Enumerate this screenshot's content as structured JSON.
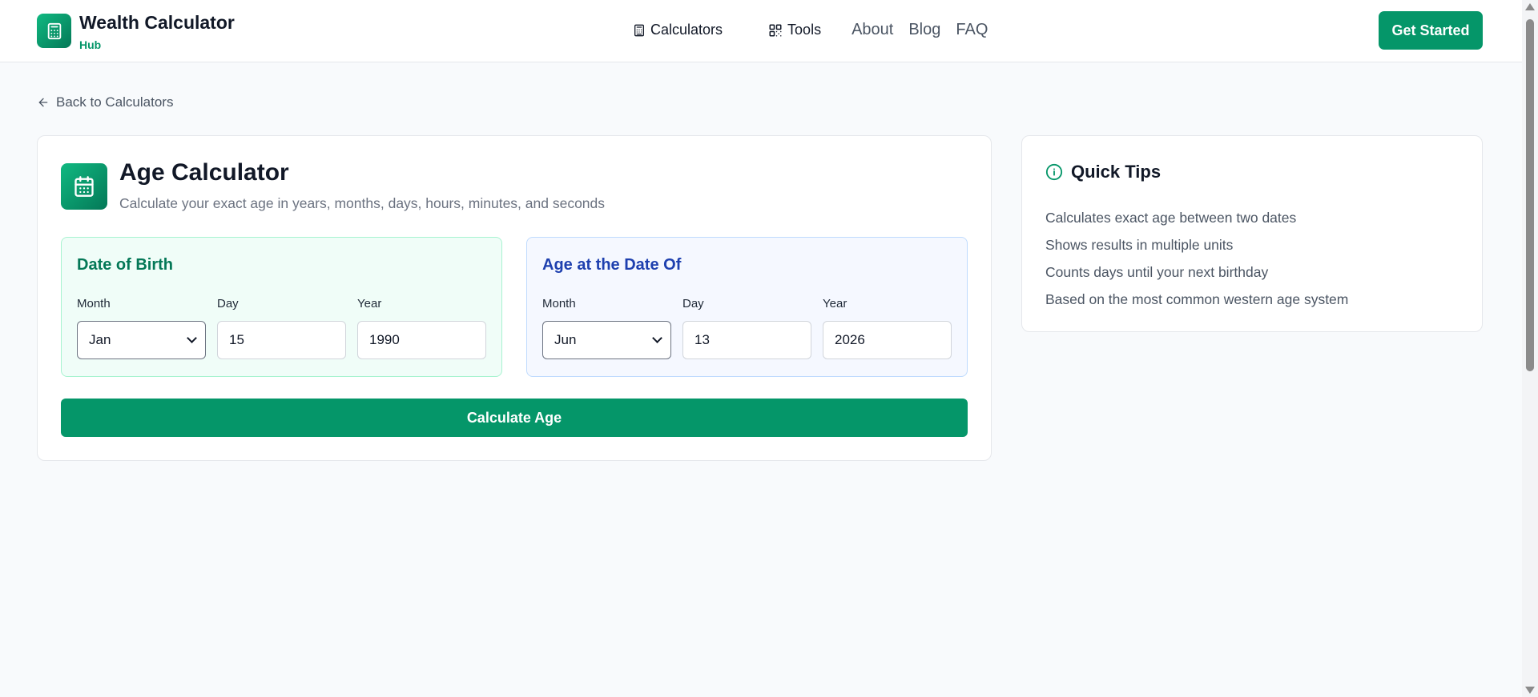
{
  "header": {
    "brand_title": "Wealth Calculator",
    "brand_subtitle": "Hub",
    "logo_icon": "calculator-icon",
    "nav": {
      "calculators": "Calculators",
      "tools": "Tools",
      "about": "About",
      "blog": "Blog",
      "faq": "FAQ"
    },
    "cta": "Get Started"
  },
  "back_link": "Back to Calculators",
  "calculator": {
    "title": "Age Calculator",
    "subtitle": "Calculate your exact age in years, months, days, hours, minutes, and seconds",
    "icon": "calendar-icon",
    "dob": {
      "title": "Date of Birth",
      "month_label": "Month",
      "day_label": "Day",
      "year_label": "Year",
      "month": "Jan",
      "day": "15",
      "year": "1990"
    },
    "at_date": {
      "title": "Age at the Date Of",
      "month_label": "Month",
      "day_label": "Day",
      "year_label": "Year",
      "month": "Jun",
      "day": "13",
      "year": "2026"
    },
    "button": "Calculate Age"
  },
  "tips": {
    "title": "Quick Tips",
    "items": [
      "Calculates exact age between two dates",
      "Shows results in multiple units",
      "Counts days until your next birthday",
      "Based on the most common western age system"
    ]
  },
  "colors": {
    "brand_green": "#059669",
    "dob_title": "#047857",
    "at_title": "#1e40af"
  }
}
